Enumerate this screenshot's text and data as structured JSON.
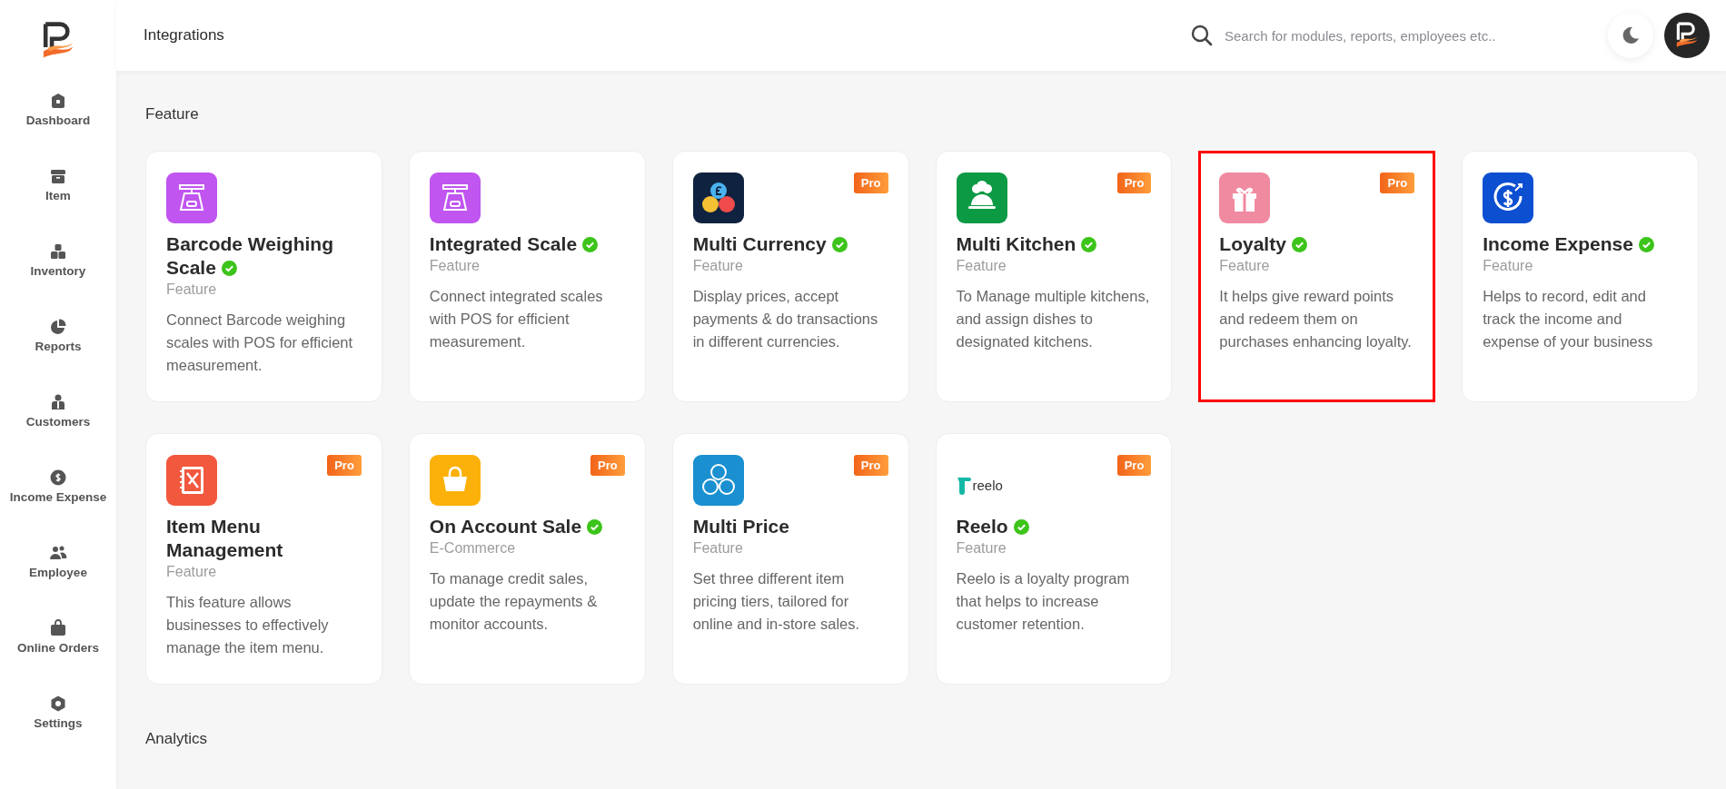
{
  "header": {
    "title": "Integrations",
    "search": {
      "placeholder": "Search for modules, reports, employees etc.."
    }
  },
  "sidebar": {
    "items": [
      {
        "label": "Dashboard",
        "selected": false
      },
      {
        "label": "Item",
        "selected": false
      },
      {
        "label": "Inventory",
        "selected": false
      },
      {
        "label": "Reports",
        "selected": false
      },
      {
        "label": "Customers",
        "selected": false
      },
      {
        "label": "Income Expense",
        "selected": false
      },
      {
        "label": "Employee",
        "selected": false
      },
      {
        "label": "Online Orders",
        "selected": false
      },
      {
        "label": "Settings",
        "selected": false
      }
    ]
  },
  "sections": [
    {
      "title": "Feature",
      "cards": [
        {
          "title": "Barcode Weighing Scale",
          "category": "Feature",
          "description": "Connect Barcode weighing scales with POS for efficient measurement.",
          "pro": false,
          "verified": true,
          "highlighted": false
        },
        {
          "title": "Integrated Scale",
          "category": "Feature",
          "description": "Connect integrated scales with POS for efficient measurement.",
          "pro": false,
          "verified": true,
          "highlighted": false
        },
        {
          "title": "Multi Currency",
          "category": "Feature",
          "description": "Display prices, accept payments & do transactions in different currencies.",
          "pro": true,
          "badge": "Pro",
          "verified": true,
          "highlighted": false
        },
        {
          "title": "Multi Kitchen",
          "category": "Feature",
          "description": "To Manage multiple kitchens, and assign dishes to designated kitchens.",
          "pro": true,
          "badge": "Pro",
          "verified": true,
          "highlighted": false
        },
        {
          "title": "Loyalty",
          "category": "Feature",
          "description": "It helps give reward points and redeem them on purchases enhancing loyalty.",
          "pro": true,
          "badge": "Pro",
          "verified": true,
          "highlighted": true
        },
        {
          "title": "Income Expense",
          "category": "Feature",
          "description": "Helps to record, edit and track the income and expense of your business",
          "pro": false,
          "verified": true,
          "highlighted": false
        },
        {
          "title": "Item Menu Management",
          "category": "Feature",
          "description": "This feature allows businesses to effectively manage the item menu.",
          "pro": true,
          "badge": "Pro",
          "verified": false,
          "highlighted": false
        },
        {
          "title": "On Account Sale",
          "category": "E-Commerce",
          "description": "To manage credit sales, update the repayments & monitor accounts.",
          "pro": true,
          "badge": "Pro",
          "verified": true,
          "highlighted": false
        },
        {
          "title": "Multi Price",
          "category": "Feature",
          "description": "Set three different item pricing tiers, tailored for online and in-store sales.",
          "pro": true,
          "badge": "Pro",
          "verified": false,
          "highlighted": false
        },
        {
          "title": "Reelo",
          "category": "Feature",
          "description": "Reelo is a loyalty program that helps to increase customer retention.",
          "pro": true,
          "badge": "Pro",
          "verified": true,
          "highlighted": false,
          "logo_text": "reelo"
        }
      ]
    },
    {
      "title": "Analytics"
    }
  ]
}
